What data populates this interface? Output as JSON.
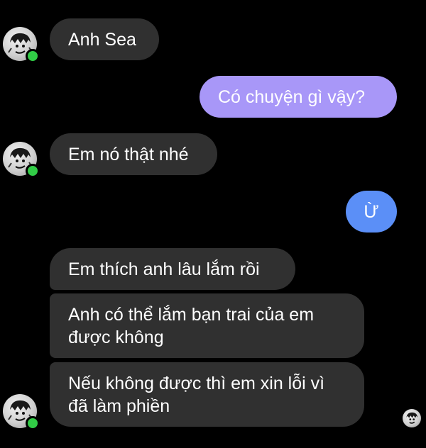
{
  "colors": {
    "background": "#000000",
    "incoming_bubble": "#303030",
    "outgoing_purple": "#a897f8",
    "outgoing_blue": "#5b8ff7",
    "online": "#31cc46"
  },
  "messages": [
    {
      "direction": "incoming",
      "text": "Anh Sea"
    },
    {
      "direction": "outgoing",
      "text": "Có chuyện gì vậy?"
    },
    {
      "direction": "incoming",
      "text": "Em nó thật nhé"
    },
    {
      "direction": "outgoing",
      "text": "Ừ"
    },
    {
      "direction": "incoming",
      "text": "Em thích anh lâu lắm rồi"
    },
    {
      "direction": "incoming",
      "text": "Anh có thể lắm bạn trai của em được không"
    },
    {
      "direction": "incoming",
      "text": "Nếu không được thì em xin lỗi vì đã làm phiền"
    }
  ],
  "icons": {
    "contact_avatar": "avatar-icon",
    "online_indicator": "online-dot-icon",
    "seen_indicator": "seen-avatar-icon"
  }
}
